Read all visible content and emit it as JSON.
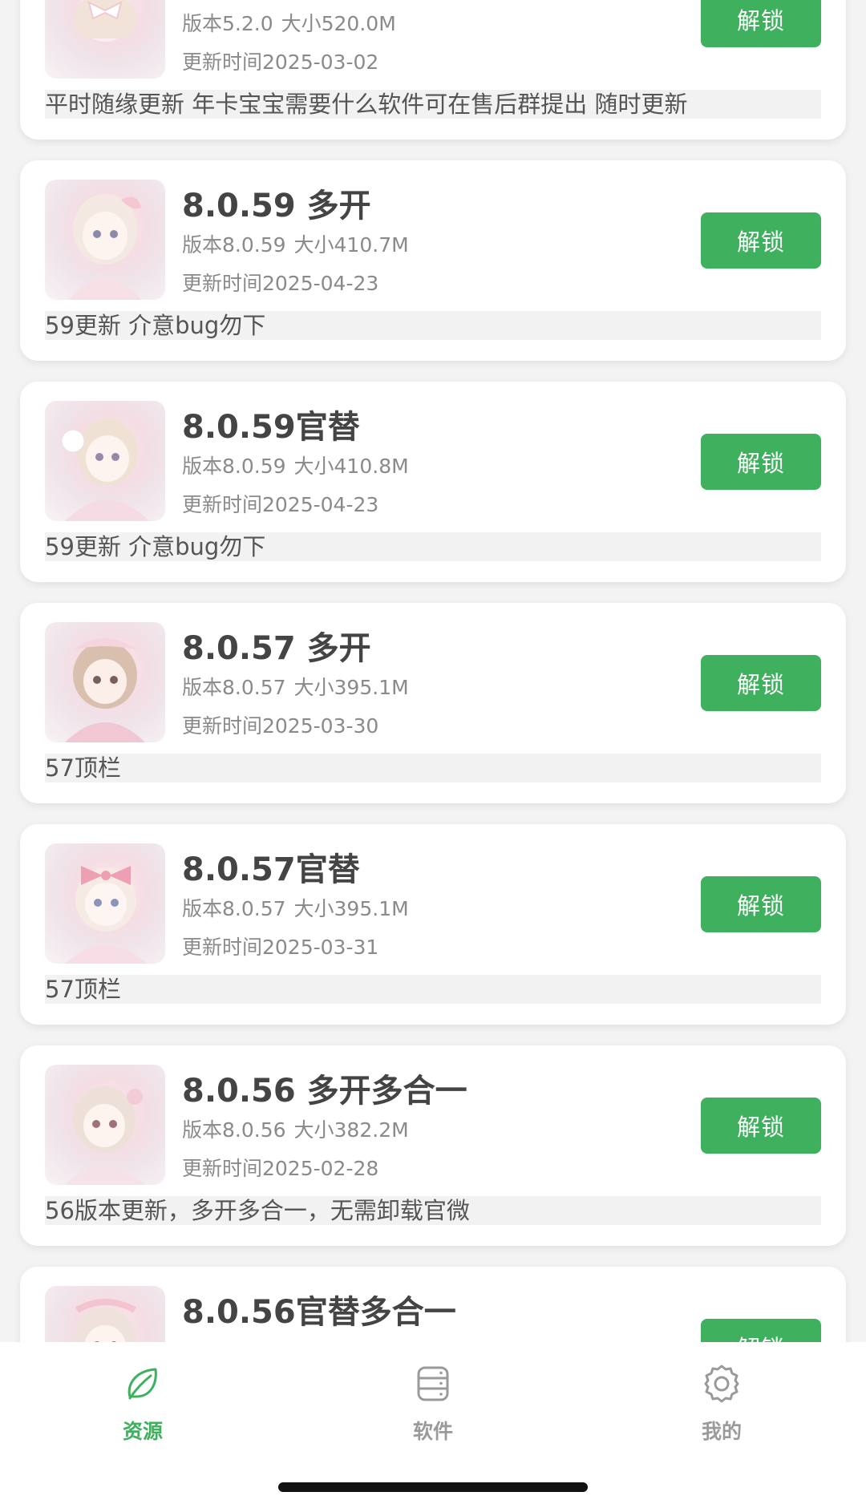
{
  "items": [
    {
      "title": "",
      "version": "版本5.2.0",
      "size": "大小520.0M",
      "updated": "更新时间2025-03-02",
      "note": "平时随缘更新 年卡宝宝需要什么软件可在售后群提出 随时更新",
      "button": "解锁"
    },
    {
      "title": "8.0.59 多开",
      "version": "版本8.0.59",
      "size": "大小410.7M",
      "updated": "更新时间2025-04-23",
      "note": "59更新 介意bug勿下",
      "button": "解锁"
    },
    {
      "title": "8.0.59官替",
      "version": "版本8.0.59",
      "size": "大小410.8M",
      "updated": "更新时间2025-04-23",
      "note": "59更新 介意bug勿下",
      "button": "解锁"
    },
    {
      "title": "8.0.57 多开",
      "version": "版本8.0.57",
      "size": "大小395.1M",
      "updated": "更新时间2025-03-30",
      "note": "57顶栏",
      "button": "解锁"
    },
    {
      "title": "8.0.57官替",
      "version": "版本8.0.57",
      "size": "大小395.1M",
      "updated": "更新时间2025-03-31",
      "note": "57顶栏",
      "button": "解锁"
    },
    {
      "title": "8.0.56 多开多合一",
      "version": "版本8.0.56",
      "size": "大小382.2M",
      "updated": "更新时间2025-02-28",
      "note": "56版本更新，多开多合一，无需卸载官微",
      "button": "解锁"
    },
    {
      "title": "8.0.56官替多合一",
      "version": "",
      "size": "",
      "updated": "",
      "note": "",
      "button": "解锁"
    }
  ],
  "tabs": [
    {
      "label": "资源",
      "icon": "leaf-icon",
      "active": true
    },
    {
      "label": "软件",
      "icon": "server-stack-icon",
      "active": false
    },
    {
      "label": "我的",
      "icon": "gear-icon",
      "active": false
    }
  ],
  "colors": {
    "accent": "#3fb05d",
    "inactive": "#9a9a9a"
  }
}
